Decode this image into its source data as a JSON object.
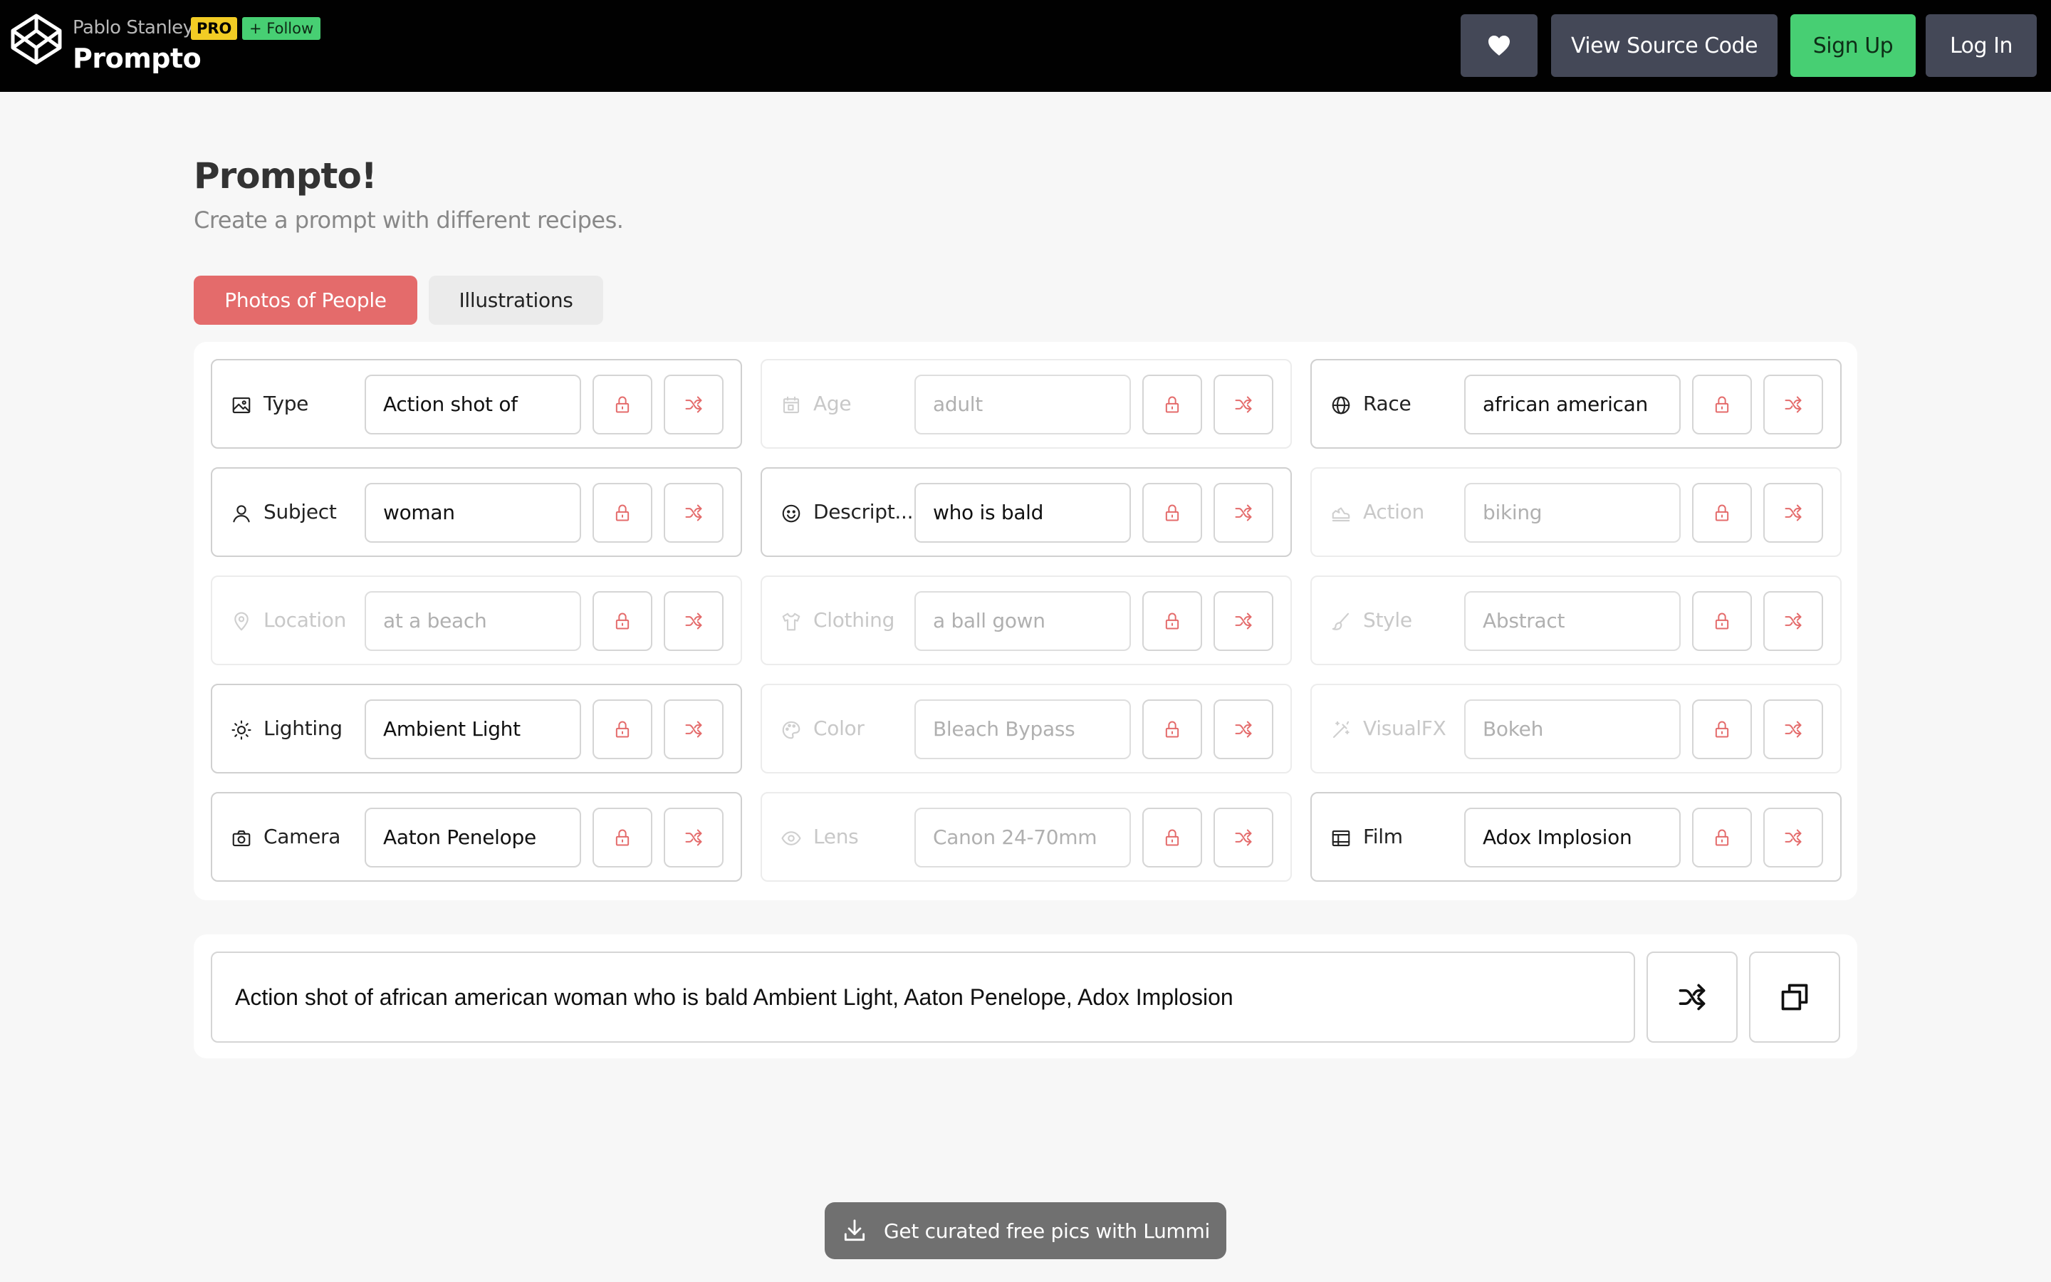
{
  "topbar": {
    "author": "Pablo Stanley",
    "pro_badge": "PRO",
    "follow_label": "+ Follow",
    "app_title": "Prompto",
    "heart_icon": "heart-icon",
    "source_label": "View Source Code",
    "signup_label": "Sign Up",
    "login_label": "Log In"
  },
  "header": {
    "title": "Prompto!",
    "subtitle": "Create a prompt with different recipes."
  },
  "tabs": [
    {
      "label": "Photos of People",
      "active": true
    },
    {
      "label": "Illustrations",
      "active": false
    }
  ],
  "cards": [
    {
      "label": "Type",
      "value": "Action shot of",
      "enabled": true,
      "icon": "image-icon"
    },
    {
      "label": "Age",
      "value": "adult",
      "enabled": false,
      "icon": "calendar-icon"
    },
    {
      "label": "Race",
      "value": "african american",
      "enabled": true,
      "icon": "globe-icon"
    },
    {
      "label": "Subject",
      "value": "woman",
      "enabled": true,
      "icon": "user-icon"
    },
    {
      "label": "Descript...",
      "value": "who is bald",
      "enabled": true,
      "icon": "smiley-icon"
    },
    {
      "label": "Action",
      "value": "biking",
      "enabled": false,
      "icon": "sneaker-icon"
    },
    {
      "label": "Location",
      "value": "at a beach",
      "enabled": false,
      "icon": "map-pin-icon"
    },
    {
      "label": "Clothing",
      "value": "a ball gown",
      "enabled": false,
      "icon": "tshirt-icon"
    },
    {
      "label": "Style",
      "value": "Abstract",
      "enabled": false,
      "icon": "paintbrush-icon"
    },
    {
      "label": "Lighting",
      "value": "Ambient Light",
      "enabled": true,
      "icon": "sun-icon"
    },
    {
      "label": "Color",
      "value": "Bleach Bypass",
      "enabled": false,
      "icon": "palette-icon"
    },
    {
      "label": "VisualFX",
      "value": "Bokeh",
      "enabled": false,
      "icon": "magic-wand-icon"
    },
    {
      "label": "Camera",
      "value": "Aaton Penelope",
      "enabled": true,
      "icon": "camera-icon"
    },
    {
      "label": "Lens",
      "value": "Canon 24-70mm",
      "enabled": false,
      "icon": "eye-icon"
    },
    {
      "label": "Film",
      "value": "Adox Implosion",
      "enabled": true,
      "icon": "film-icon"
    }
  ],
  "card_buttons": {
    "lock_icon": "lock-icon",
    "shuffle_icon": "shuffle-icon"
  },
  "output": {
    "prompt": "Action shot of african american woman who is bald Ambient Light, Aaton Penelope, Adox Implosion",
    "shuffle_icon": "shuffle-icon",
    "copy_icon": "copy-icon"
  },
  "lummi": {
    "label": "Get curated free pics with Lummi",
    "icon": "download-icon"
  },
  "colors": {
    "accent": "#e46b6b",
    "green": "#47cf73",
    "topbar": "#010101",
    "button_dark": "#444857",
    "pro": "#f2cc24"
  }
}
